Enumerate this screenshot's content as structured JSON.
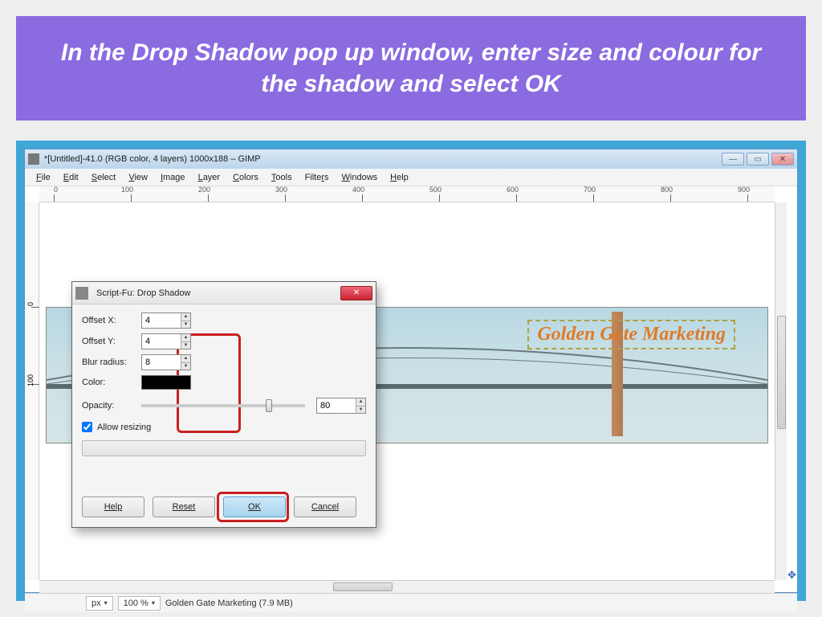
{
  "banner": {
    "text": "In the Drop Shadow pop up window, enter size and colour for the shadow and select OK"
  },
  "window": {
    "title": "*[Untitled]-41.0 (RGB color, 4 layers) 1000x188 – GIMP",
    "menus": [
      "File",
      "Edit",
      "Select",
      "View",
      "Image",
      "Layer",
      "Colors",
      "Tools",
      "Filters",
      "Windows",
      "Help"
    ],
    "ruler_marks": [
      "0",
      "100",
      "200",
      "300",
      "400",
      "500",
      "600",
      "700",
      "800",
      "900"
    ],
    "vruler_marks": [
      "0",
      "100"
    ],
    "canvas_text": "Golden Gate Marketing",
    "status": {
      "unit": "px",
      "zoom": "100 %",
      "layer": "Golden Gate Marketing (7.9 MB)"
    }
  },
  "dialog": {
    "title": "Script-Fu: Drop Shadow",
    "fields": {
      "offset_x_label": "Offset X:",
      "offset_x": "4",
      "offset_y_label": "Offset Y:",
      "offset_y": "4",
      "blur_label": "Blur radius:",
      "blur": "8",
      "color_label": "Color:",
      "opacity_label": "Opacity:",
      "opacity": "80",
      "allow_resize": "Allow resizing"
    },
    "buttons": {
      "help": "Help",
      "reset": "Reset",
      "ok": "OK",
      "cancel": "Cancel"
    }
  }
}
